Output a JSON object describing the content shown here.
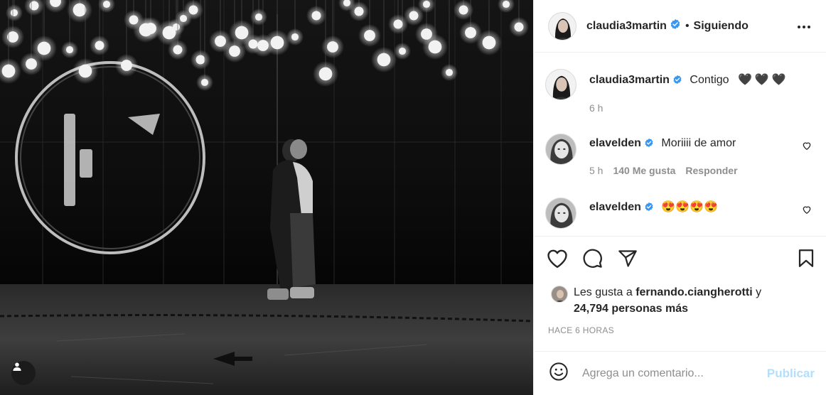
{
  "post": {
    "author": "claudia3martin",
    "follow_state": "Siguiendo",
    "dot": "•",
    "caption": "Contigo",
    "caption_hearts": "🖤🖤🖤",
    "caption_time": "6 h"
  },
  "comments": [
    {
      "user": "elavelden",
      "text": "Moriiii de amor",
      "time": "5 h",
      "likes": "140 Me gusta",
      "reply": "Responder"
    },
    {
      "user": "elavelden",
      "text": "😍😍😍😍",
      "time": "",
      "likes": "",
      "reply": ""
    }
  ],
  "likes": {
    "prefix": "Les gusta a",
    "liker": "fernando.ciangherotti",
    "joiner": "y",
    "others": "24,794 personas más"
  },
  "timestamp": "HACE 6 HORAS",
  "composer": {
    "placeholder": "Agrega un comentario...",
    "post_label": "Publicar"
  },
  "icons": {
    "header_more": "more-horizontal-icon",
    "verified": "verified-badge-icon",
    "like": "heart-icon",
    "comment": "comment-icon",
    "share": "share-icon",
    "save": "bookmark-icon",
    "emoji": "emoji-icon",
    "tag": "user-tag-icon"
  },
  "colors": {
    "verified": "#3897f0",
    "publish_disabled": "#b2dffc",
    "muted": "#8e8e8e"
  }
}
